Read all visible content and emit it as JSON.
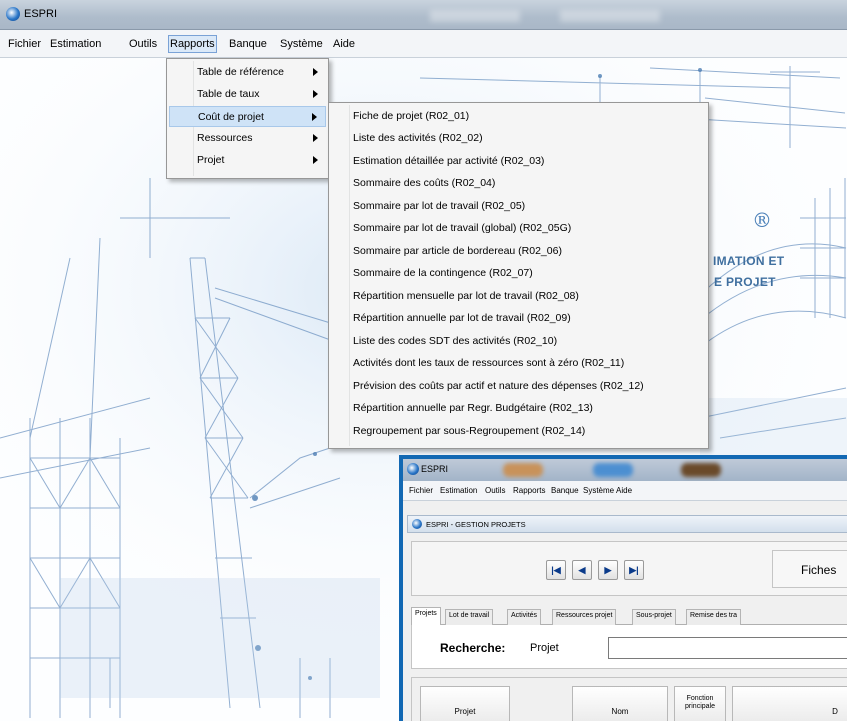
{
  "window": {
    "title": "ESPRI"
  },
  "menubar": {
    "items": [
      {
        "label": "Fichier"
      },
      {
        "label": "Estimation"
      },
      {
        "label": "Outils"
      },
      {
        "label": "Rapports"
      },
      {
        "label": "Banque"
      },
      {
        "label": "Système"
      },
      {
        "label": "Aide"
      }
    ]
  },
  "background": {
    "registered_mark": "®",
    "line1": "IMATION ET",
    "line2": "E PROJET"
  },
  "rapports_menu": {
    "items": [
      {
        "label": "Table de référence",
        "submenu": true
      },
      {
        "label": "Table de taux",
        "submenu": true
      },
      {
        "label": "Coût de projet",
        "submenu": true,
        "highlighted": true
      },
      {
        "label": "Ressources",
        "submenu": true
      },
      {
        "label": "Projet",
        "submenu": true
      }
    ]
  },
  "cout_projet_menu": {
    "items": [
      {
        "label": "Fiche de projet (R02_01)"
      },
      {
        "label": "Liste des activités (R02_02)"
      },
      {
        "label": "Estimation détaillée par activité (R02_03)"
      },
      {
        "label": "Sommaire des coûts (R02_04)"
      },
      {
        "label": "Sommaire par lot de travail (R02_05)"
      },
      {
        "label": "Sommaire par lot de travail (global) (R02_05G)"
      },
      {
        "label": "Sommaire par article de bordereau (R02_06)"
      },
      {
        "label": "Sommaire de la contingence (R02_07)"
      },
      {
        "label": "Répartition mensuelle par lot de travail (R02_08)"
      },
      {
        "label": "Répartition annuelle par lot de travail (R02_09)"
      },
      {
        "label": "Liste des codes SDT des activités (R02_10)"
      },
      {
        "label": "Activités dont les taux de ressources sont à zéro (R02_11)"
      },
      {
        "label": "Prévision des coûts par actif et nature des dépenses (R02_12)"
      },
      {
        "label": "Répartition annuelle par Regr. Budgétaire (R02_13)"
      },
      {
        "label": "Regroupement par sous-Regroupement (R02_14)"
      }
    ]
  },
  "inset": {
    "title": "ESPRI",
    "menu": [
      "Fichier",
      "Estimation",
      "Outils",
      "Rapports",
      "Banque",
      "Système",
      "Aide"
    ],
    "subwindow_title": "ESPRI - GESTION PROJETS",
    "nav": {
      "first": "|◀",
      "prev": "◀",
      "next": "▶",
      "last": "▶|"
    },
    "fiches_label": "Fiches",
    "tabs": [
      "Projets",
      "Lot de travail",
      "Activités",
      "Ressources projet",
      "Sous-projet",
      "Remise des tra"
    ],
    "search_label": "Recherche:",
    "search_field_label": "Projet",
    "search_value": "",
    "columns": [
      {
        "label": "Projet"
      },
      {
        "label": "Nom"
      },
      {
        "label": "Fonction principale"
      },
      {
        "label": "D"
      }
    ]
  },
  "colors": {
    "menu_highlight": "#cfe3f7",
    "accent_border": "#1268b3",
    "illustration_blue": "#6f95c2"
  }
}
